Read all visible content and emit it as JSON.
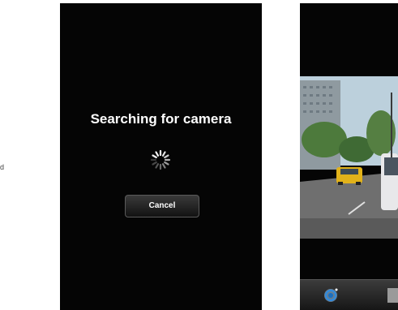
{
  "side_label": "d",
  "left_screen": {
    "title": "Searching for camera",
    "cancel_label": "Cancel"
  },
  "right_screen": {
    "camera_button_icon": "camera-shutter-icon",
    "gallery_button_icon": "gallery-icon"
  },
  "colors": {
    "screen_bg": "#050505",
    "title_text": "#ffffff",
    "toolbar": "#2a2a2a"
  }
}
